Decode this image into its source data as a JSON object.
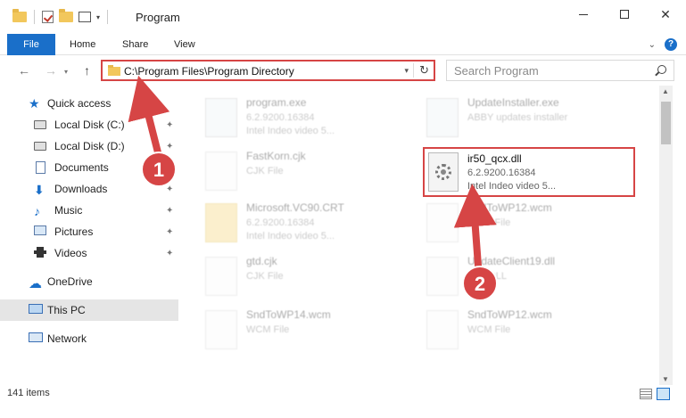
{
  "window": {
    "title": "Program",
    "minimize_glyph": "",
    "maximize_glyph": "",
    "close_glyph": "✕"
  },
  "ribbon": {
    "tabs": [
      {
        "label": "File"
      },
      {
        "label": "Home"
      },
      {
        "label": "Share"
      },
      {
        "label": "View"
      }
    ],
    "help": "?"
  },
  "nav": {
    "back": "←",
    "forward": "→",
    "recent": "▾",
    "up": "↑",
    "address": "C:\\Program Files\\Program Directory",
    "address_drop": "▾",
    "refresh": "↻",
    "search_placeholder": "Search Program"
  },
  "sidebar": {
    "items": [
      {
        "label": "Quick access",
        "icon": "star-icon"
      },
      {
        "label": "Local Disk (C:)",
        "icon": "disk-icon",
        "pinned": true
      },
      {
        "label": "Local Disk (D:)",
        "icon": "disk-icon",
        "pinned": true
      },
      {
        "label": "Documents",
        "icon": "document-icon",
        "pinned": true
      },
      {
        "label": "Downloads",
        "icon": "download-icon",
        "pinned": true
      },
      {
        "label": "Music",
        "icon": "music-icon",
        "pinned": true
      },
      {
        "label": "Pictures",
        "icon": "picture-icon",
        "pinned": true
      },
      {
        "label": "Videos",
        "icon": "video-icon",
        "pinned": true
      },
      {
        "label": "OneDrive",
        "icon": "cloud-icon"
      },
      {
        "label": "This PC",
        "icon": "computer-icon",
        "selected": true
      },
      {
        "label": "Network",
        "icon": "network-icon"
      }
    ],
    "pin_glyph": "📌"
  },
  "files": [
    {
      "name": "program.exe",
      "line1": "6.2.9200.16384",
      "line2": "Intel Indeo video 5..."
    },
    {
      "name": "UpdateInstaller.exe",
      "line1": "ABBY updates installer",
      "line2": ""
    },
    {
      "name": "FastKorn.cjk",
      "line1": "CJK File",
      "line2": ""
    },
    {
      "name": "Microsoft.VC90.CRT",
      "line1": "6.2.9200.16384",
      "line2": "Intel Indeo video 5..."
    },
    {
      "name": "SndToWP12.wcm",
      "line1": "WCM File",
      "line2": ""
    },
    {
      "name": "gtd.cjk",
      "line1": "CJK File",
      "line2": ""
    },
    {
      "name": "UpdateClient19.dll",
      "line1": "...ce DLL",
      "line2": ""
    },
    {
      "name": "SndToWP14.wcm",
      "line1": "WCM File",
      "line2": ""
    },
    {
      "name": "SndToWP12.wcm",
      "line1": "WCM File",
      "line2": ""
    }
  ],
  "highlighted_file": {
    "name": "ir50_qcx.dll",
    "line1": "6.2.9200.16384",
    "line2": "Intel Indeo video 5..."
  },
  "callouts": [
    "1",
    "2"
  ],
  "status": {
    "item_count": "141 items"
  },
  "colors": {
    "accent": "#1a6fc9",
    "annotation_red": "#d64545"
  }
}
